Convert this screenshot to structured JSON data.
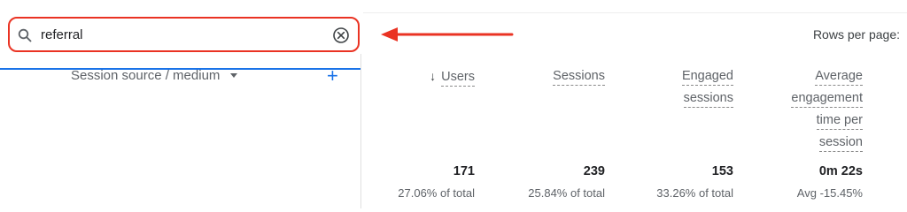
{
  "search": {
    "value": "referral",
    "icon": "search-icon",
    "clear_icon": "close-circle-icon"
  },
  "annotation": {
    "arrow_color": "#ea3323",
    "field_outline_color": "#ea3323"
  },
  "rows_per_page_label": "Rows per page:",
  "dimension": {
    "label": "Session source / medium",
    "add_symbol": "+"
  },
  "metrics": [
    {
      "header_lines": [
        "Users"
      ],
      "sorted_desc": true,
      "sort_symbol": "↓",
      "total": "171",
      "sub": "27.06% of total"
    },
    {
      "header_lines": [
        "Sessions"
      ],
      "sorted_desc": false,
      "total": "239",
      "sub": "25.84% of total"
    },
    {
      "header_lines": [
        "Engaged",
        "sessions"
      ],
      "sorted_desc": false,
      "total": "153",
      "sub": "33.26% of total"
    },
    {
      "header_lines": [
        "Average",
        "engagement",
        "time per",
        "session"
      ],
      "sorted_desc": false,
      "total": "0m 22s",
      "sub": "Avg -15.45%"
    }
  ],
  "colors": {
    "accent": "#1a73e8",
    "annotation_red": "#ea3323"
  }
}
